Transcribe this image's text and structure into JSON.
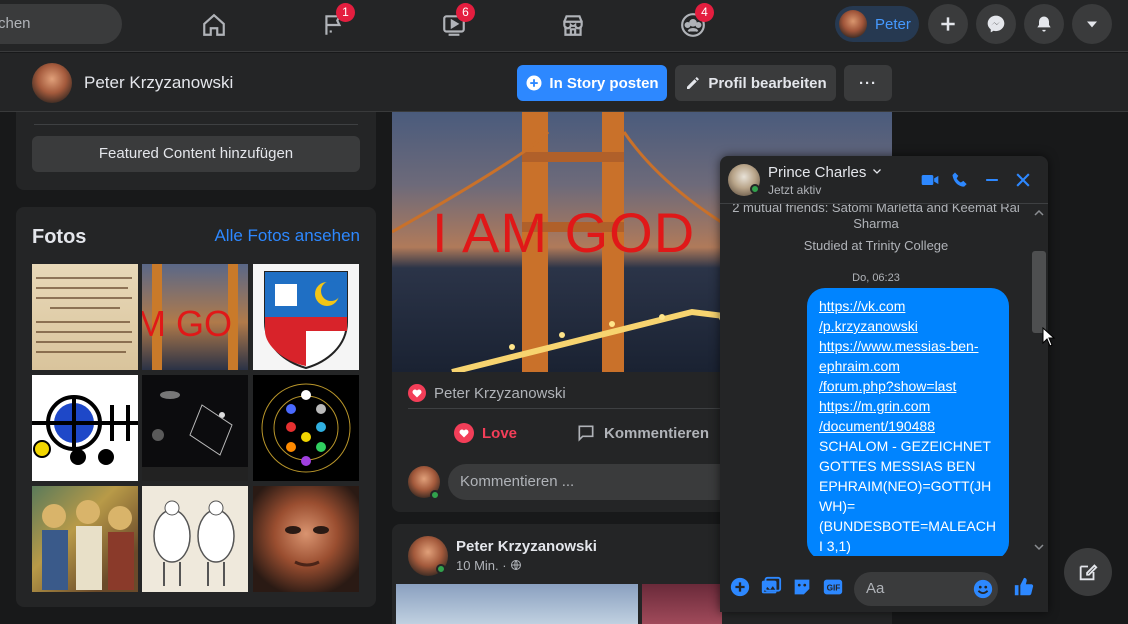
{
  "topbar": {
    "search_placeholder": "chen",
    "nav": [
      {
        "name": "home",
        "badge": ""
      },
      {
        "name": "pages",
        "badge": "1"
      },
      {
        "name": "watch",
        "badge": "6"
      },
      {
        "name": "marketplace",
        "badge": ""
      },
      {
        "name": "groups",
        "badge": "4"
      }
    ],
    "profile_name": "Peter"
  },
  "profile_bar": {
    "name": "Peter Krzyzanowski",
    "story_button": "In Story posten",
    "edit_button": "Profil bearbeiten",
    "more_button": "···"
  },
  "left": {
    "featured_button": "Featured Content hinzufügen",
    "photos_title": "Fotos",
    "photos_link": "Alle Fotos ansehen"
  },
  "post1": {
    "image_text": "I AM GOD",
    "reaction_name": "Peter Krzyzanowski",
    "love_label": "Love",
    "comment_label": "Kommentieren",
    "comment_placeholder": "Kommentieren ..."
  },
  "post2": {
    "author": "Peter Krzyzanowski",
    "time": "10 Min. ·"
  },
  "chat": {
    "contact": "Prince Charles",
    "status": "Jetzt aktiv",
    "mutual": "2 mutual friends: Satomi Marletta and Keemat Rai Sharma",
    "studied": "Studied at Trinity College",
    "timestamp": "Do, 06:23",
    "message_lines": [
      {
        "text": "https://vk.com",
        "link": true
      },
      {
        "text": "/p.krzyzanowski",
        "link": true
      },
      {
        "text": "https://www.messias-ben-",
        "link": true
      },
      {
        "text": "ephraim.com",
        "link": true
      },
      {
        "text": "/forum.php?show=last",
        "link": true
      },
      {
        "text": "https://m.grin.com",
        "link": true
      },
      {
        "text": "/document/190488",
        "link": true
      },
      {
        "text": "SCHALOM - GEZEICHNET",
        "link": false
      },
      {
        "text": "GOTTES MESSIAS BEN",
        "link": false
      },
      {
        "text": "EPHRAIM(NEO)=GOTT(JH",
        "link": false
      },
      {
        "text": "WH)=",
        "link": false
      },
      {
        "text": "(BUNDESBOTE=MALEACH",
        "link": false
      },
      {
        "text": "I 3,1)",
        "link": false
      }
    ],
    "input_placeholder": "Aa"
  },
  "colors": {
    "accent": "#2d88ff",
    "bubble": "#0084ff",
    "badge": "#e41e3f",
    "love": "#f33e58",
    "online": "#31a24c"
  }
}
